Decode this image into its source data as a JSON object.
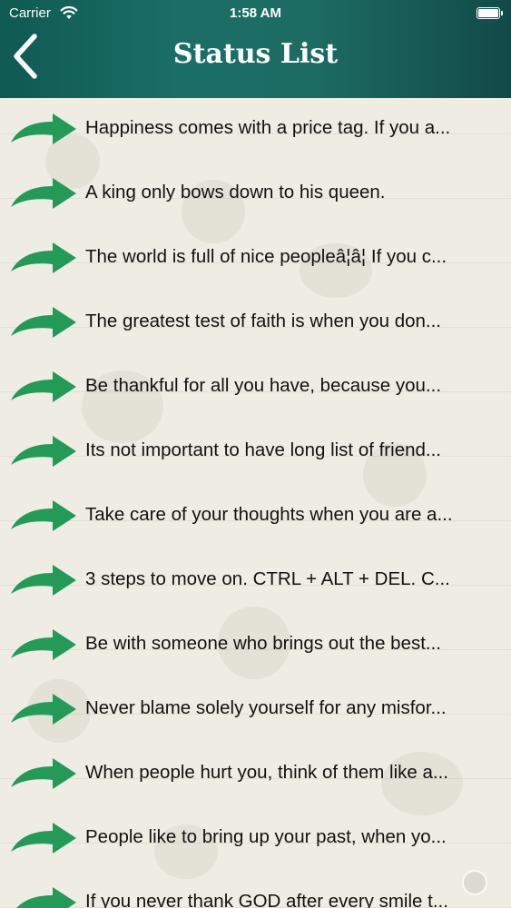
{
  "status_bar": {
    "carrier": "Carrier",
    "time": "1:58 AM",
    "wifi_icon": "wifi-icon",
    "battery_icon": "battery-icon"
  },
  "header": {
    "title": "Status List",
    "back_icon": "chevron-left-icon",
    "gradient_colors": [
      "#0f5a52",
      "#1d6c64",
      "#124a49"
    ]
  },
  "list": {
    "arrow_icon": "curved-arrow-right-icon",
    "arrow_color": "#239a57",
    "items": [
      {
        "text": "Happiness comes with a price tag. If you a..."
      },
      {
        "text": "A king only bows down to his queen."
      },
      {
        "text": "The world is full of nice peopleâ¦â¦ If you c..."
      },
      {
        "text": "The greatest test of faith is when you don..."
      },
      {
        "text": "Be thankful for all you have, because you..."
      },
      {
        "text": "Its not important to have long list of friend..."
      },
      {
        "text": "Take care of your thoughts when you are a..."
      },
      {
        "text": "3 steps to move on. CTRL + ALT + DEL. C..."
      },
      {
        "text": "Be with someone who brings out the best..."
      },
      {
        "text": "Never blame solely yourself for any misfor..."
      },
      {
        "text": "When people hurt you, think of them like a..."
      },
      {
        "text": "People like to bring up your past, when yo..."
      },
      {
        "text": "If you never thank GOD after every smile t..."
      }
    ]
  }
}
